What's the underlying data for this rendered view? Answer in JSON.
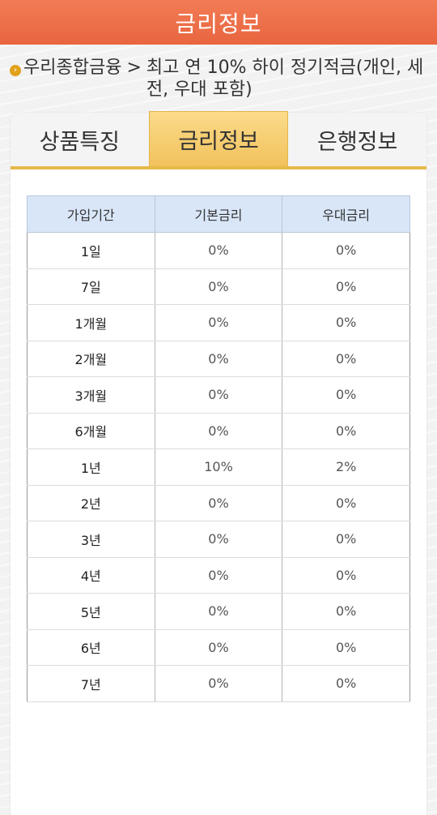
{
  "header": {
    "title": "금리정보"
  },
  "breadcrumb": {
    "parent": "우리종합금융",
    "separator": ">",
    "current": "최고 연 10% 하이 정기적금(개인, 세전, 우대 포함)",
    "bullet_icon": "chevron-circle-icon"
  },
  "tabs": [
    {
      "label": "상품특징",
      "active": false
    },
    {
      "label": "금리정보",
      "active": true
    },
    {
      "label": "은행정보",
      "active": false
    }
  ],
  "table": {
    "headers": [
      "가입기간",
      "기본금리",
      "우대금리"
    ],
    "rows": [
      [
        "1일",
        "0%",
        "0%"
      ],
      [
        "7일",
        "0%",
        "0%"
      ],
      [
        "1개월",
        "0%",
        "0%"
      ],
      [
        "2개월",
        "0%",
        "0%"
      ],
      [
        "3개월",
        "0%",
        "0%"
      ],
      [
        "6개월",
        "0%",
        "0%"
      ],
      [
        "1년",
        "10%",
        "2%"
      ],
      [
        "2년",
        "0%",
        "0%"
      ],
      [
        "3년",
        "0%",
        "0%"
      ],
      [
        "4년",
        "0%",
        "0%"
      ],
      [
        "5년",
        "0%",
        "0%"
      ],
      [
        "6년",
        "0%",
        "0%"
      ],
      [
        "7년",
        "0%",
        "0%"
      ]
    ]
  },
  "colors": {
    "header_bg": "#ee7049",
    "tab_active": "#f5cc6b",
    "table_header_bg": "#d9e6f8",
    "bullet": "#e0a21b"
  }
}
